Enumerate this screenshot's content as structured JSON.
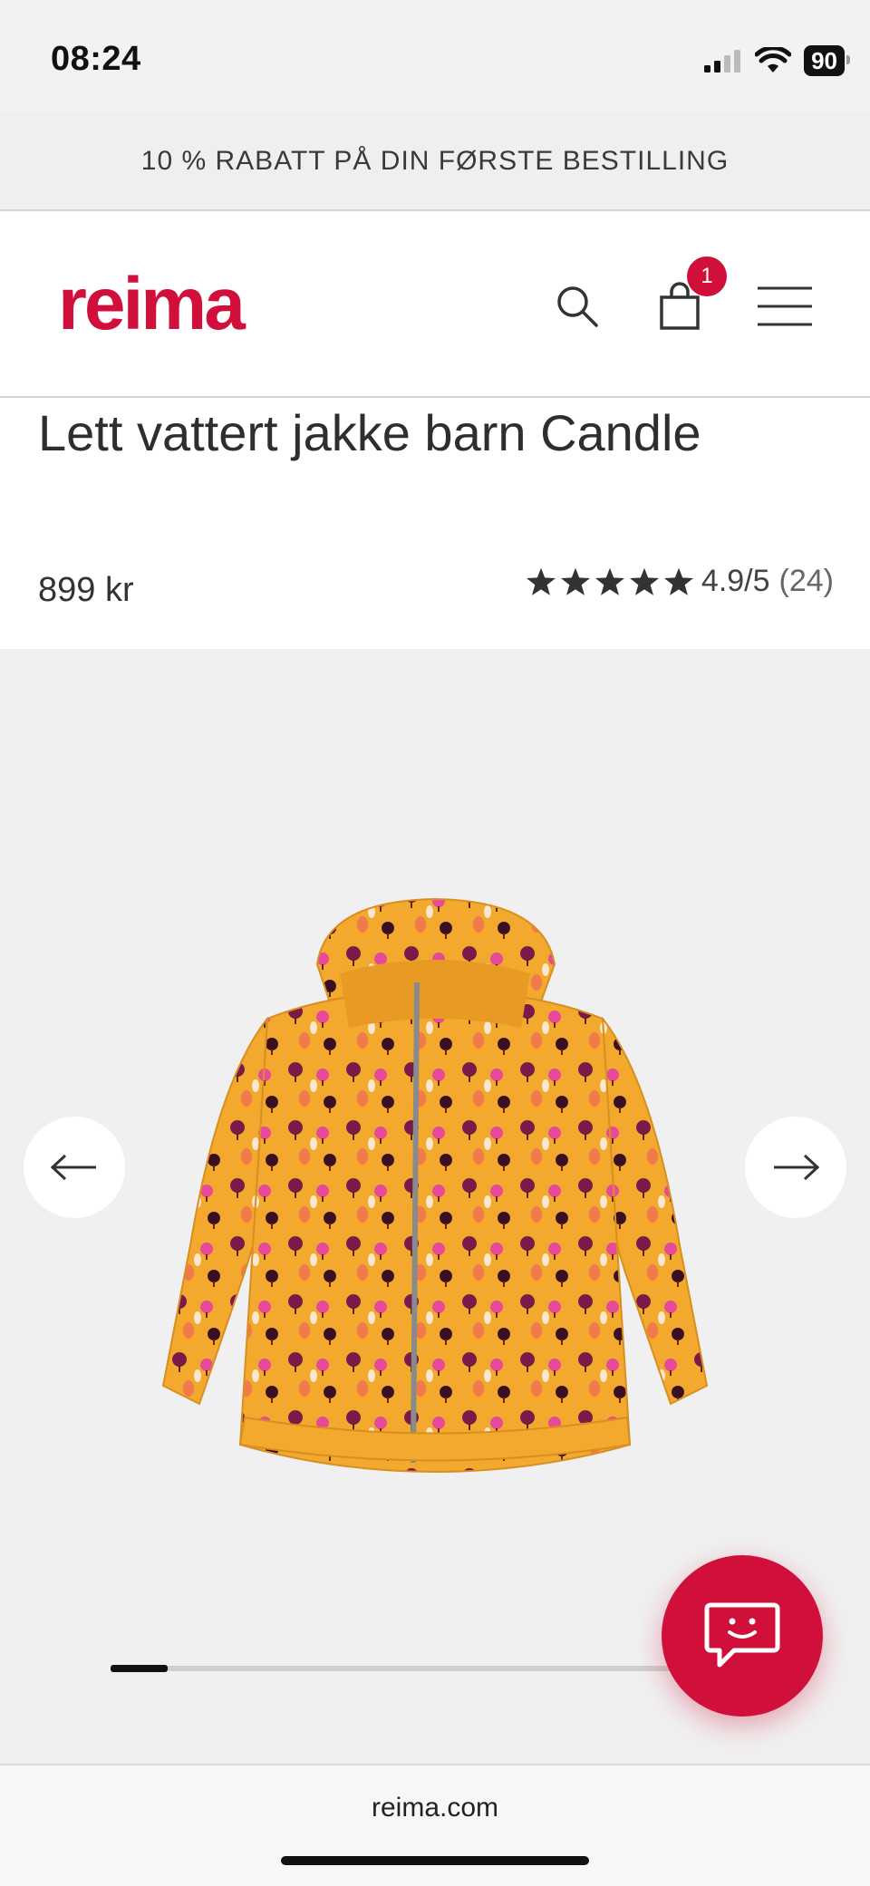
{
  "status_bar": {
    "time": "08:24",
    "battery": "90"
  },
  "promo": {
    "text": "10 % RABATT PÅ DIN FØRSTE BESTILLING"
  },
  "header": {
    "logo_text": "reima",
    "cart_count": "1",
    "brand_color": "#d0103a"
  },
  "product": {
    "title": "Lett vattert jakke barn Candle",
    "price": "899 kr",
    "rating": {
      "score": "4.9/5",
      "count": "(24)",
      "stars": 5
    }
  },
  "gallery": {
    "image_alt": "Yellow jacket with tree print",
    "current_position": 0.1
  },
  "chat": {
    "icon": "chat-icon"
  },
  "bottom_bar": {
    "url": "reima.com"
  }
}
